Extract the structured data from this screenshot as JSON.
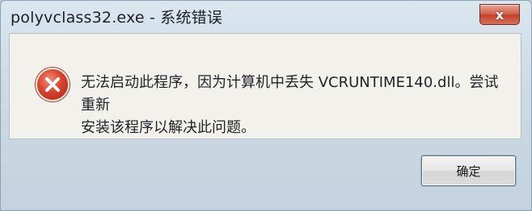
{
  "window": {
    "title": "polyvclass32.exe - 系统错误",
    "close_glyph": "x"
  },
  "dialog": {
    "icon": "error-icon",
    "message_line1": "无法启动此程序，因为计算机中丢失 VCRUNTIME140.dll。尝试重新",
    "message_line2": "安装该程序以解决此问题。"
  },
  "buttons": {
    "ok_label": "确定"
  },
  "colors": {
    "close_button": "#c2432d",
    "error_icon": "#d9432c",
    "content_background": "#f3f1ec"
  }
}
